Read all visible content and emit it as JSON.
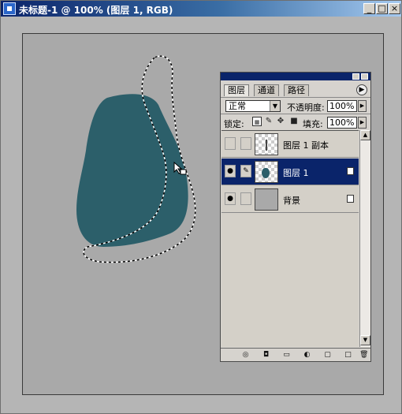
{
  "window": {
    "title": "未标题-1 @ 100% (图层 1, RGB)",
    "buttons": {
      "minimize": "_",
      "restore": "□",
      "close": "×"
    }
  },
  "colors": {
    "shape_fill": "#2c5f6a",
    "selected_layer": "#0a246a",
    "titlebar": "#0b246a"
  },
  "layers_panel": {
    "tabs": [
      "图层",
      "通道",
      "路径"
    ],
    "active_tab": "图层",
    "blend_mode": "正常",
    "opacity_label": "不透明度:",
    "opacity_value": "100%",
    "lock_label": "锁定:",
    "fill_label": "填充:",
    "fill_value": "100%",
    "layers": [
      {
        "name": "图层 1 副本",
        "visible": false,
        "selected": false,
        "thumb": "transparent-text",
        "locked": false
      },
      {
        "name": "图层 1",
        "visible": true,
        "selected": true,
        "thumb": "transparent-shape",
        "locked": true
      },
      {
        "name": "背景",
        "visible": true,
        "selected": false,
        "thumb": "gray-fill",
        "locked": true
      }
    ],
    "bottom_icons": [
      "link-icon",
      "layer-style-icon",
      "mask-icon",
      "new-set-icon",
      "adjustment-icon",
      "new-layer-icon",
      "trash-icon"
    ]
  },
  "icons": {
    "eye": "eye-icon",
    "brush": "paintbrush-icon",
    "lock": "lock-icon",
    "move_cursor": "move-cursor-icon"
  }
}
